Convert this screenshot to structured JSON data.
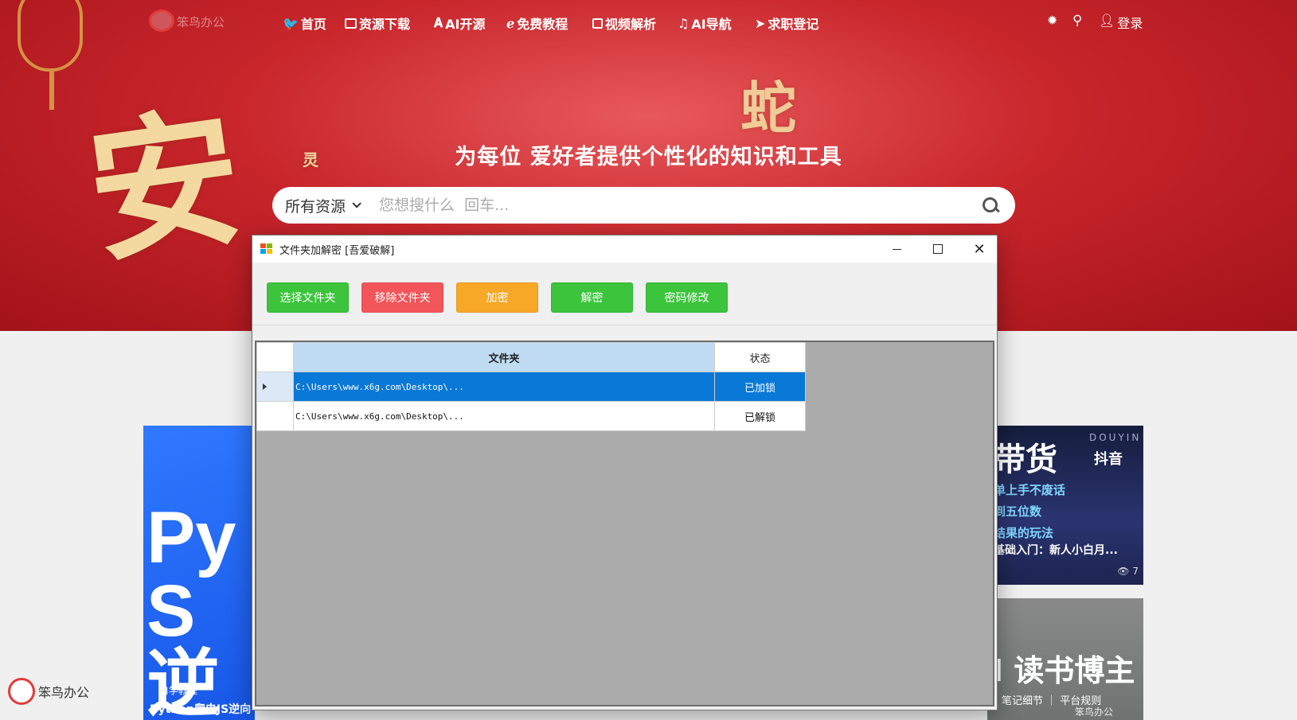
{
  "site": {
    "logo_text": "笨鸟办公",
    "nav": [
      {
        "label": "首页",
        "icon": "bird-icon"
      },
      {
        "label": "资源下载",
        "icon": "monitor-icon"
      },
      {
        "label": "AI开源",
        "icon": "ai-icon"
      },
      {
        "label": "免费教程",
        "icon": "edge-icon"
      },
      {
        "label": "视频解析",
        "icon": "video-icon"
      },
      {
        "label": "AI导航",
        "icon": "music-icon"
      },
      {
        "label": "求职登记",
        "icon": "send-icon"
      }
    ],
    "nav_right": {
      "login_label": "登录"
    },
    "hero_title": "为每位 爱好者提供个性化的知识和工具",
    "search": {
      "scope": "所有资源",
      "placeholder": "您想搜什么  回车..."
    },
    "deco": {
      "char1": "安",
      "char2": "灵",
      "char3": "蛇"
    },
    "cards": {
      "left": {
        "big": "Py\nS逆",
        "sub": "自学教程",
        "caption": "Python爬虫JS逆向"
      },
      "right1": {
        "title": "带货",
        "brand_en": "DOUYIN",
        "brand": "抖音",
        "line1": "单上手不废话",
        "line2": "到五位数",
        "line3": "结果的玩法",
        "caption": "基础入门：新人小白月...",
        "views": "7"
      },
      "right2": {
        "title": "I 读书博主",
        "sub": "笔记细节 ｜ 平台规则",
        "watermark": "笨鸟办公"
      }
    },
    "bottom_logo": "笨鸟办公"
  },
  "app": {
    "title": "文件夹加解密 [吾爱破解]",
    "buttons": [
      {
        "label": "选择文件夹",
        "color": "#3cc43c"
      },
      {
        "label": "移除文件夹",
        "color": "#f2555a"
      },
      {
        "label": "加密",
        "color": "#f7a827"
      },
      {
        "label": "解密",
        "color": "#3cc43c"
      },
      {
        "label": "密码修改",
        "color": "#3cc43c"
      }
    ],
    "grid": {
      "columns": [
        "文件夹",
        "状态"
      ],
      "rows": [
        {
          "path": "C:\\Users\\www.x6g.com\\Desktop\\...",
          "status": "已加锁",
          "selected": true
        },
        {
          "path": "C:\\Users\\www.x6g.com\\Desktop\\...",
          "status": "已解锁",
          "selected": false
        }
      ]
    }
  }
}
